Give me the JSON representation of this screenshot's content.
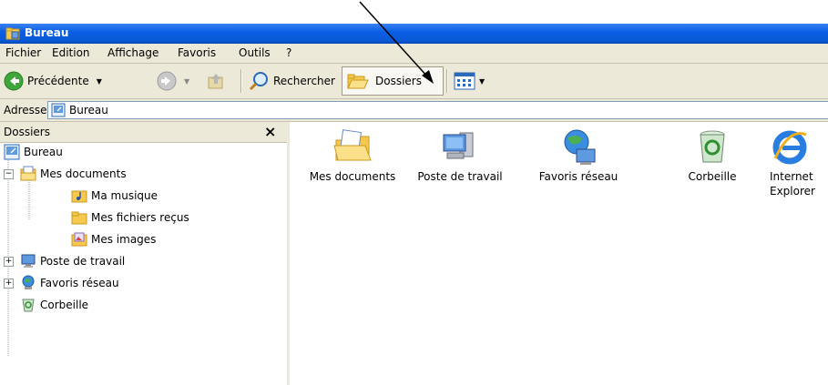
{
  "window": {
    "title": "Bureau"
  },
  "menu": [
    "Fichier",
    "Edition",
    "Affichage",
    "Favoris",
    "Outils",
    "?"
  ],
  "toolbar": {
    "back_label": "Précédente",
    "search_label": "Rechercher",
    "folders_label": "Dossiers"
  },
  "address": {
    "label": "Adresse",
    "value": "Bureau"
  },
  "folders_pane": {
    "title": "Dossiers",
    "close": "×",
    "tree": [
      {
        "label": "Bureau",
        "icon": "desktop-icon"
      },
      {
        "label": "Mes documents",
        "icon": "my-documents-icon",
        "expander": "−"
      },
      {
        "label": "Ma musique",
        "icon": "music-folder-icon"
      },
      {
        "label": "Mes fichiers reçus",
        "icon": "folder-icon"
      },
      {
        "label": "Mes images",
        "icon": "pictures-folder-icon"
      },
      {
        "label": "Poste de travail",
        "icon": "computer-icon",
        "expander": "+"
      },
      {
        "label": "Favoris réseau",
        "icon": "network-icon",
        "expander": "+"
      },
      {
        "label": "Corbeille",
        "icon": "recycle-bin-icon"
      }
    ]
  },
  "items": [
    {
      "label": "Mes documents",
      "icon": "my-documents-icon"
    },
    {
      "label": "Poste de travail",
      "icon": "computer-icon"
    },
    {
      "label": "Favoris réseau",
      "icon": "network-icon"
    },
    {
      "label": "Corbeille",
      "icon": "recycle-bin-icon"
    },
    {
      "label": "Internet Explorer",
      "icon": "internet-explorer-icon"
    }
  ],
  "colors": {
    "titlebar": "#0a5fe4",
    "chrome": "#ece9d8",
    "back_arrow": "#3fa63a"
  }
}
